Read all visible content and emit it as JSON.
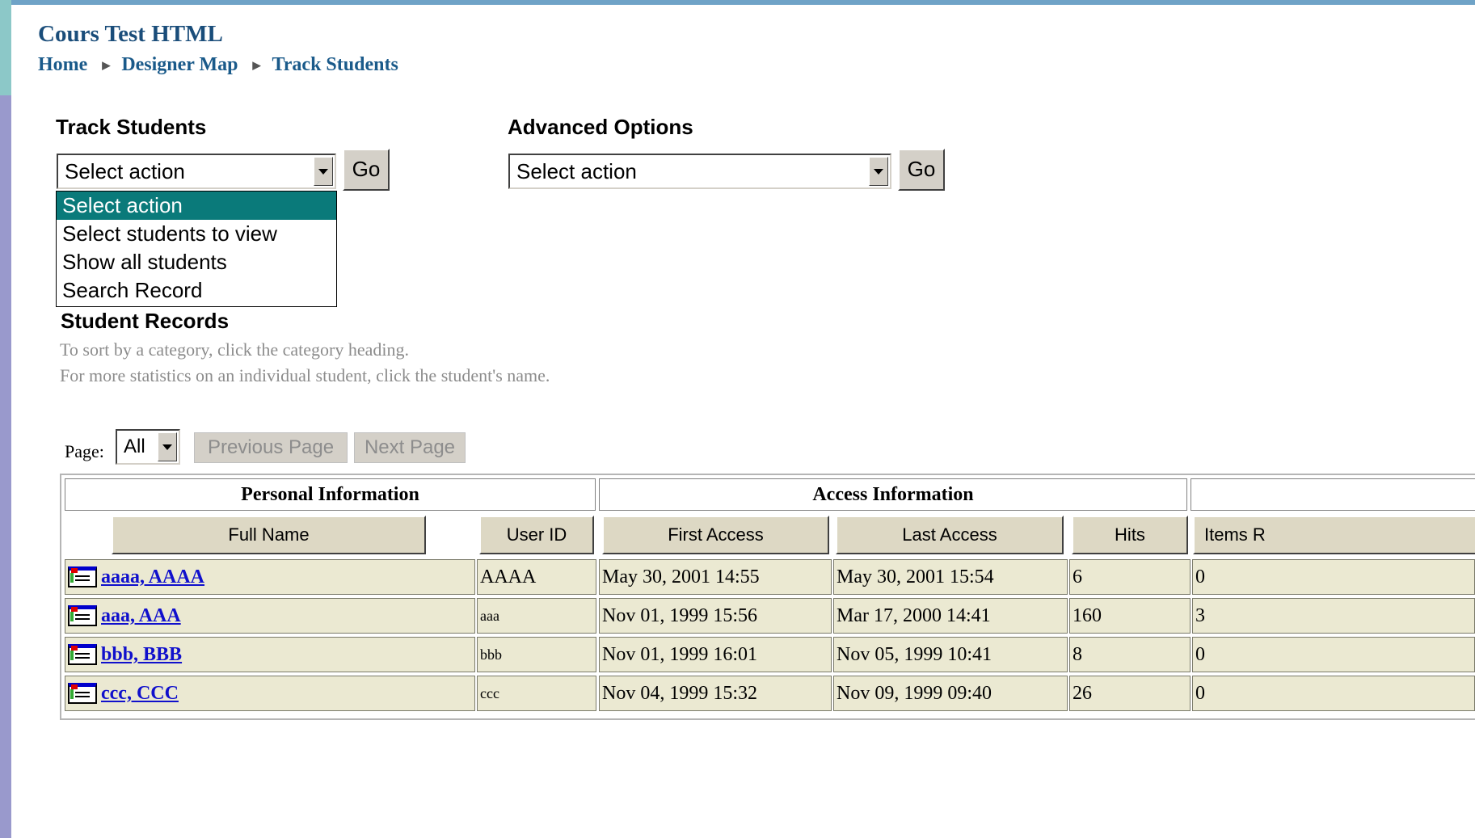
{
  "course": {
    "title": "Cours Test HTML"
  },
  "breadcrumb": [
    {
      "label": "Home"
    },
    {
      "label": "Designer Map"
    },
    {
      "label": "Track Students"
    }
  ],
  "track_students": {
    "heading": "Track Students",
    "selected_action": "Select action",
    "go_label": "Go",
    "options": [
      "Select action",
      "Select students to view",
      "Show all students",
      "Search Record"
    ],
    "highlighted_option": "Select action"
  },
  "advanced_options": {
    "heading": "Advanced Options",
    "selected_action": "Select action",
    "go_label": "Go"
  },
  "student_records": {
    "heading": "Student Records",
    "hint_sort": "To sort by a category, click the category heading.",
    "hint_stats": "For more statistics on an individual student, click the student's name."
  },
  "pager": {
    "label": "Page:",
    "selected": "All",
    "previous_label": "Previous Page",
    "next_label": "Next Page"
  },
  "table": {
    "groups": [
      "Personal Information",
      "Access Information"
    ],
    "columns": [
      "Full Name",
      "User ID",
      "First Access",
      "Last Access",
      "Hits",
      "Items R"
    ],
    "rows": [
      {
        "name": "aaaa, AAAA",
        "user_id": "AAAA",
        "first_access": "May 30, 2001 14:55",
        "last_access": "May 30, 2001 15:54",
        "hits": "6",
        "items": "0"
      },
      {
        "name": "aaa, AAA",
        "user_id": "aaa",
        "first_access": "Nov 01, 1999 15:56",
        "last_access": "Mar 17, 2000 14:41",
        "hits": "160",
        "items": "3"
      },
      {
        "name": "bbb, BBB",
        "user_id": "bbb",
        "first_access": "Nov 01, 1999 16:01",
        "last_access": "Nov 05, 1999 10:41",
        "hits": "8",
        "items": "0"
      },
      {
        "name": "ccc, CCC",
        "user_id": "ccc",
        "first_access": "Nov 04, 1999 15:32",
        "last_access": "Nov 09, 1999 09:40",
        "hits": "26",
        "items": "0"
      }
    ]
  },
  "icons": {
    "student_record": "student-record-icon",
    "dropdown": "chevron-down-icon"
  },
  "colors": {
    "highlight": "#0a7a7a",
    "link": "#1010cc",
    "title": "#1a4d7a",
    "row_bg": "#ebe9d2"
  }
}
